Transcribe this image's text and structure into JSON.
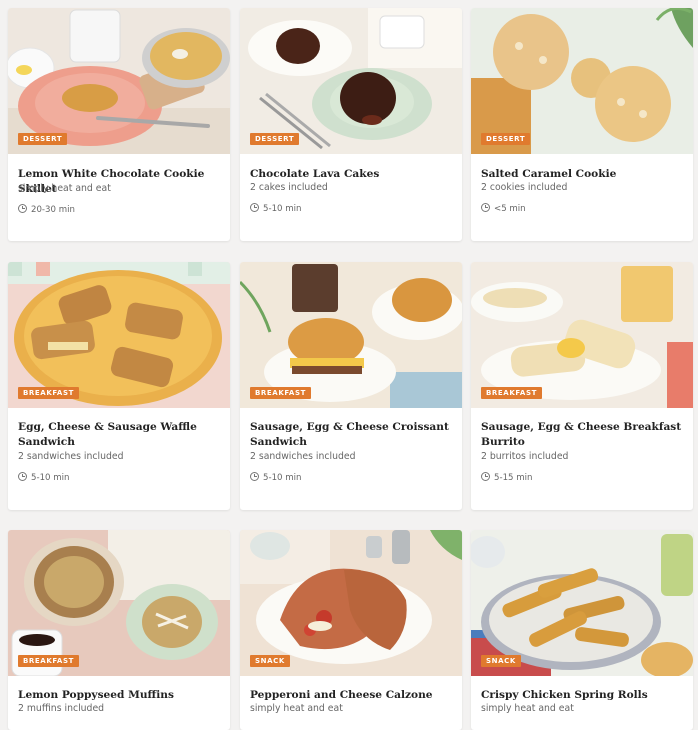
{
  "cards": [
    {
      "badge": "DESSERT",
      "title": "Lemon White Chocolate Cookie Skillet",
      "subtitle": "simply heat and eat",
      "time": "20-30 min"
    },
    {
      "badge": "DESSERT",
      "title": "Chocolate Lava Cakes",
      "subtitle": "2 cakes included",
      "time": "5-10 min"
    },
    {
      "badge": "DESSERT",
      "title": "Salted Caramel Cookie",
      "subtitle": "2 cookies included",
      "time": "<5 min"
    },
    {
      "badge": "BREAKFAST",
      "title": "Egg, Cheese & Sausage Waffle Sandwich",
      "subtitle": "2 sandwiches included",
      "time": "5-10 min"
    },
    {
      "badge": "BREAKFAST",
      "title": "Sausage, Egg & Cheese Croissant Sandwich",
      "subtitle": "2 sandwiches included",
      "time": "5-10 min"
    },
    {
      "badge": "BREAKFAST",
      "title": "Sausage, Egg & Cheese Breakfast Burrito",
      "subtitle": "2 burritos included",
      "time": "5-15 min"
    },
    {
      "badge": "BREAKFAST",
      "title": "Lemon Poppyseed Muffins",
      "subtitle": "2 muffins included",
      "time": ""
    },
    {
      "badge": "SNACK",
      "title": "Pepperoni and Cheese Calzone",
      "subtitle": "simply heat and eat",
      "time": ""
    },
    {
      "badge": "SNACK",
      "title": "Crispy Chicken Spring Rolls",
      "subtitle": "simply heat and eat",
      "time": ""
    }
  ],
  "icons": {
    "time": "clock-icon"
  },
  "colors": {
    "badge": "#e07a2e"
  }
}
